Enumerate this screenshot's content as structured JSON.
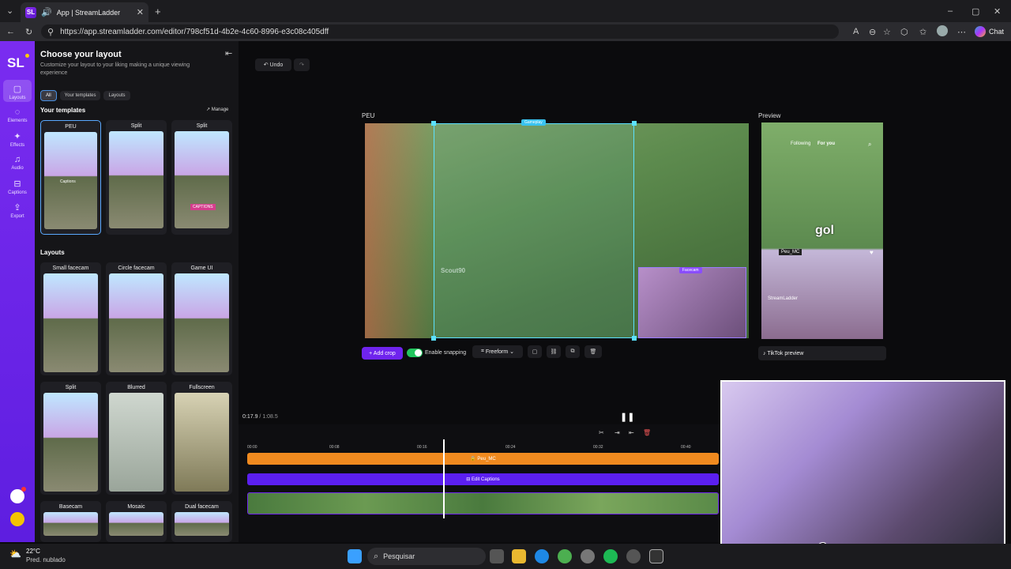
{
  "browser": {
    "tab_title": "App | StreamLadder",
    "favicon": "SL",
    "url": "https://app.streamladder.com/editor/798cf51d-4b2e-4c60-8996-e3c08c405dff",
    "chat_label": "Chat"
  },
  "rail": {
    "logo": "SL",
    "items": [
      {
        "label": "Layouts",
        "icon": "layout-icon"
      },
      {
        "label": "Elements",
        "icon": "elements-icon"
      },
      {
        "label": "Effects",
        "icon": "effects-icon"
      },
      {
        "label": "Audio",
        "icon": "audio-icon"
      },
      {
        "label": "Captions",
        "icon": "captions-icon"
      },
      {
        "label": "Export",
        "icon": "export-icon"
      }
    ]
  },
  "sidebar": {
    "title": "Choose your layout",
    "subtitle": "Customize your layout to your liking making a unique viewing experience",
    "filters": [
      "All",
      "Your templates",
      "Layouts"
    ],
    "templates_heading": "Your templates",
    "manage_label": "Manage",
    "templates": [
      "PEU",
      "Split",
      "Split"
    ],
    "layouts_heading": "Layouts",
    "layouts": [
      "Small facecam",
      "Circle facecam",
      "Game UI",
      "Split",
      "Blurred",
      "Fullscreen",
      "Basecam",
      "Mosaic",
      "Dual facecam"
    ],
    "thumb_captions": "Captions",
    "thumb_captions_upper": "CAPTIONS"
  },
  "editor": {
    "undo_label": "Undo",
    "source_label": "PEU",
    "preview_label": "Preview",
    "gameplay_tag": "Gameplay",
    "facecam_tag": "Facecam",
    "add_crop_label": "+ Add crop",
    "snapping_label": "Enable snapping",
    "snapping_on": true,
    "freeform_label": "Freeform",
    "tiktok_preview_label": "TikTok preview",
    "watermark": "Scout90",
    "preview_following": "Following",
    "preview_foryou": "For you",
    "preview_gol": "gol",
    "preview_username": "Peu_MC",
    "preview_streamladder": "StreamLadder"
  },
  "timeline": {
    "current_time": "0:17.9",
    "duration": "1:08.5",
    "ticks": [
      "00:00",
      "00:08",
      "00:16",
      "00:24",
      "00:32",
      "00:40"
    ],
    "track_peu": "Peu_MC",
    "track_captions": "Edit Captions",
    "colors": {
      "orange": "#f08a1f",
      "purple": "#5b1ff0",
      "playhead": "#ffffff"
    }
  },
  "webcam_overlay": {
    "handle": "@peu_mc"
  },
  "taskbar": {
    "temperature": "22°C",
    "weather": "Pred. nublado",
    "search_label": "Pesquisar"
  },
  "colors": {
    "accent": "#6f24ee",
    "cyan": "#5ce1ff",
    "bg": "#0b0b0d"
  }
}
